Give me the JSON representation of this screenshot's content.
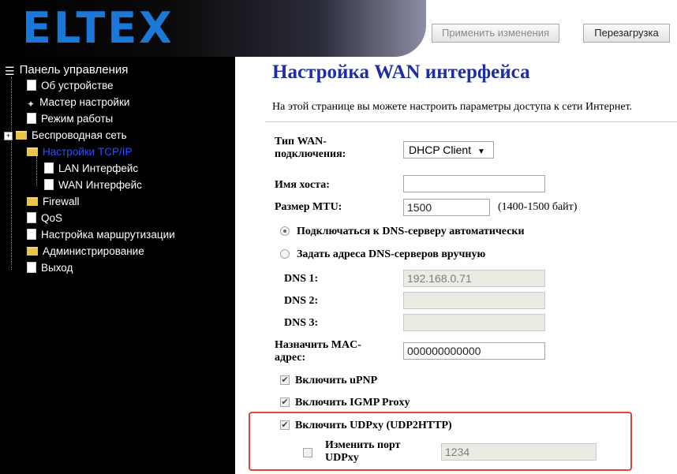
{
  "header": {
    "logo_text": "ELTEX",
    "apply_button": "Применить изменения",
    "reboot_button": "Перезагрузка",
    "logo_color": "#1a78d8"
  },
  "sidebar": {
    "root": "Панель управления",
    "items": [
      {
        "label": "Об устройстве",
        "icon": "document-icon"
      },
      {
        "label": "Мастер настройки",
        "icon": "wand-icon"
      },
      {
        "label": "Режим работы",
        "icon": "document-icon"
      },
      {
        "label": "Беспроводная сеть",
        "icon": "folder-icon"
      },
      {
        "label": "Настройки TCP/IP",
        "icon": "folder-open-icon",
        "active": true
      },
      {
        "label": "LAN Интерфейс",
        "icon": "document-icon"
      },
      {
        "label": "WAN Интерфейс",
        "icon": "document-icon"
      },
      {
        "label": "Firewall",
        "icon": "folder-icon"
      },
      {
        "label": "QoS",
        "icon": "document-icon"
      },
      {
        "label": "Настройка маршрутизации",
        "icon": "document-icon"
      },
      {
        "label": "Администрирование",
        "icon": "folder-icon"
      },
      {
        "label": "Выход",
        "icon": "document-icon"
      }
    ],
    "active_color": "#2f4dff"
  },
  "main": {
    "title": "Настройка WAN интерфейса",
    "description": "На этой странице вы можете настроить параметры доступа к сети Интернет.",
    "wan_type_label_1": "Тип WAN-",
    "wan_type_label_2": "подключения:",
    "wan_type_value": "DHCP Client",
    "hostname_label": "Имя хоста:",
    "hostname_value": "",
    "mtu_label": "Размер MTU:",
    "mtu_value": "1500",
    "mtu_note": "(1400-1500 байт)",
    "dns_auto_label": "Подключаться к DNS-серверу автоматически",
    "dns_manual_label": "Задать адреса DNS-серверов вручную",
    "dns1_label": "DNS 1:",
    "dns1_value": "192.168.0.71",
    "dns2_label": "DNS 2:",
    "dns2_value": "",
    "dns3_label": "DNS 3:",
    "dns3_value": "",
    "mac_label_1": "Назначить MAC-",
    "mac_label_2": "адрес:",
    "mac_value": "000000000000",
    "upnp_label": "Включить uPNP",
    "igmp_label": "Включить IGMP Proxy",
    "udpxy_label": "Включить UDPxy (UDP2HTTP)",
    "udpxy_port_label_1": "Изменить порт",
    "udpxy_port_label_2": "UDPxy",
    "udpxy_port_value": "1234",
    "highlight_color": "#e0443a"
  }
}
